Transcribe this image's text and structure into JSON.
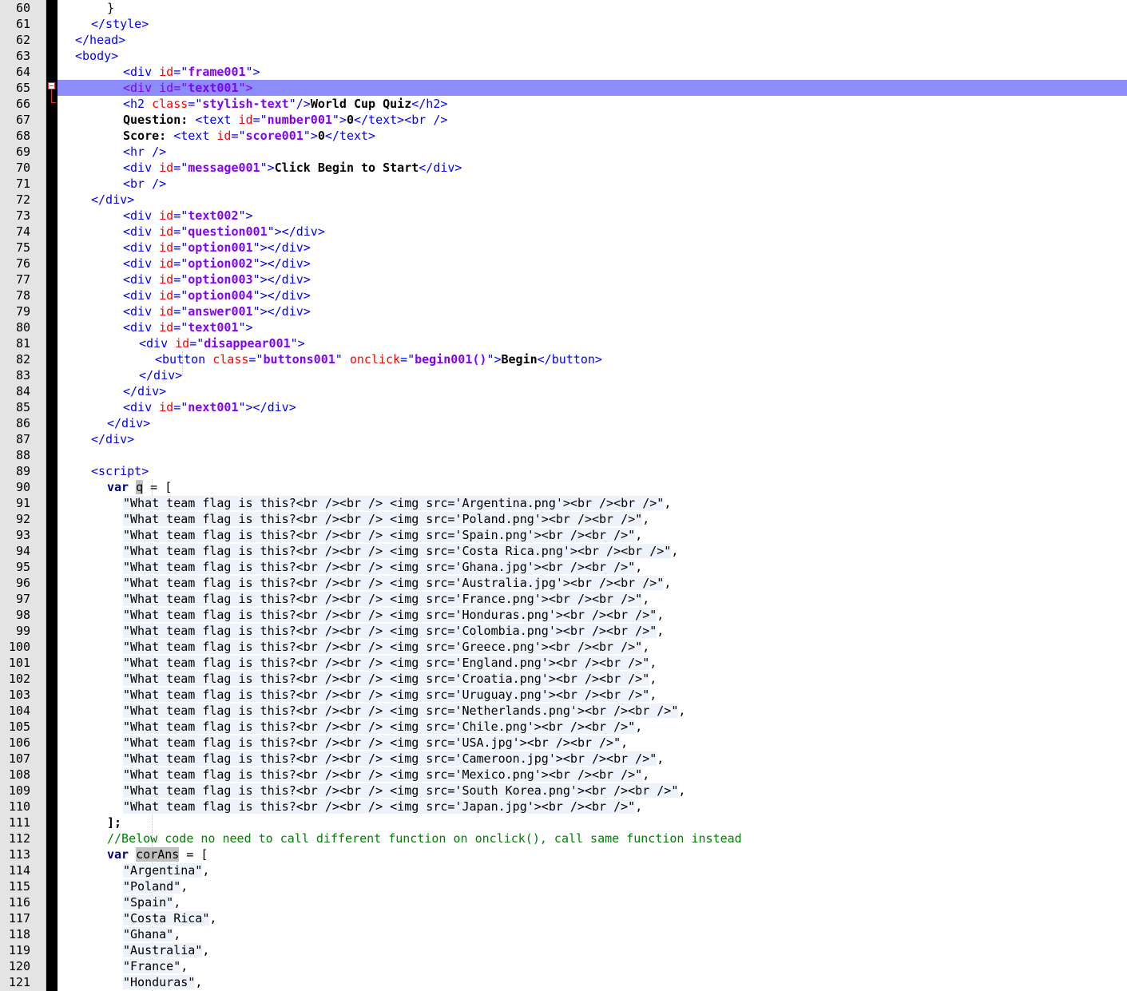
{
  "editor": {
    "lines": [
      {
        "n": "60",
        "ind": 6,
        "tok": [
          [
            "p",
            "}"
          ]
        ]
      },
      {
        "n": "61",
        "ind": 4,
        "tok": [
          [
            "t",
            "</style>"
          ]
        ]
      },
      {
        "n": "62",
        "ind": 2,
        "tok": [
          [
            "t",
            "</head>"
          ]
        ]
      },
      {
        "n": "63",
        "ind": 2,
        "tok": [
          [
            "t",
            "<body>"
          ]
        ]
      },
      {
        "n": "64",
        "ind": 8,
        "tok": [
          [
            "t",
            "<div "
          ],
          [
            "a",
            "id"
          ],
          [
            "t",
            "=\""
          ],
          [
            "v",
            "frame001"
          ],
          [
            "t",
            "\">"
          ]
        ]
      },
      {
        "n": "65",
        "ind": 8,
        "cur": true,
        "tok": [
          [
            "t",
            "<div "
          ],
          [
            "a",
            "id"
          ],
          [
            "t",
            "=\""
          ],
          [
            "v",
            "text001"
          ],
          [
            "t",
            "\">"
          ]
        ]
      },
      {
        "n": "66",
        "ind": 8,
        "tok": [
          [
            "t",
            "<h2 "
          ],
          [
            "a",
            "class"
          ],
          [
            "t",
            "=\""
          ],
          [
            "v",
            "stylish-text"
          ],
          [
            "t",
            "\"/>"
          ],
          [
            "b",
            "World Cup Quiz"
          ],
          [
            "t",
            "</h2>"
          ]
        ]
      },
      {
        "n": "67",
        "ind": 8,
        "tok": [
          [
            "b",
            "Question: "
          ],
          [
            "t",
            "<text "
          ],
          [
            "a",
            "id"
          ],
          [
            "t",
            "=\""
          ],
          [
            "v",
            "number001"
          ],
          [
            "t",
            "\">"
          ],
          [
            "b",
            "0"
          ],
          [
            "t",
            "</text><br />"
          ]
        ]
      },
      {
        "n": "68",
        "ind": 8,
        "tok": [
          [
            "b",
            "Score: "
          ],
          [
            "t",
            "<text "
          ],
          [
            "a",
            "id"
          ],
          [
            "t",
            "=\""
          ],
          [
            "v",
            "score001"
          ],
          [
            "t",
            "\">"
          ],
          [
            "b",
            "0"
          ],
          [
            "t",
            "</text>"
          ]
        ]
      },
      {
        "n": "69",
        "ind": 8,
        "tok": [
          [
            "t",
            "<hr />"
          ]
        ]
      },
      {
        "n": "70",
        "ind": 8,
        "tok": [
          [
            "t",
            "<div "
          ],
          [
            "a",
            "id"
          ],
          [
            "t",
            "=\""
          ],
          [
            "v",
            "message001"
          ],
          [
            "t",
            "\">"
          ],
          [
            "b",
            "Click Begin to Start"
          ],
          [
            "t",
            "</div>"
          ]
        ]
      },
      {
        "n": "71",
        "ind": 8,
        "tok": [
          [
            "t",
            "<br />"
          ]
        ]
      },
      {
        "n": "72",
        "ind": 4,
        "tok": [
          [
            "t",
            "</div>"
          ]
        ]
      },
      {
        "n": "73",
        "ind": 8,
        "tok": [
          [
            "t",
            "<div "
          ],
          [
            "a",
            "id"
          ],
          [
            "t",
            "=\""
          ],
          [
            "v",
            "text002"
          ],
          [
            "t",
            "\">"
          ]
        ]
      },
      {
        "n": "74",
        "ind": 8,
        "tok": [
          [
            "t",
            "<div "
          ],
          [
            "a",
            "id"
          ],
          [
            "t",
            "=\""
          ],
          [
            "v",
            "question001"
          ],
          [
            "t",
            "\"></div>"
          ]
        ]
      },
      {
        "n": "75",
        "ind": 8,
        "tok": [
          [
            "t",
            "<div "
          ],
          [
            "a",
            "id"
          ],
          [
            "t",
            "=\""
          ],
          [
            "v",
            "option001"
          ],
          [
            "t",
            "\"></div>"
          ]
        ]
      },
      {
        "n": "76",
        "ind": 8,
        "tok": [
          [
            "t",
            "<div "
          ],
          [
            "a",
            "id"
          ],
          [
            "t",
            "=\""
          ],
          [
            "v",
            "option002"
          ],
          [
            "t",
            "\"></div>"
          ]
        ]
      },
      {
        "n": "77",
        "ind": 8,
        "tok": [
          [
            "t",
            "<div "
          ],
          [
            "a",
            "id"
          ],
          [
            "t",
            "=\""
          ],
          [
            "v",
            "option003"
          ],
          [
            "t",
            "\"></div>"
          ]
        ]
      },
      {
        "n": "78",
        "ind": 8,
        "tok": [
          [
            "t",
            "<div "
          ],
          [
            "a",
            "id"
          ],
          [
            "t",
            "=\""
          ],
          [
            "v",
            "option004"
          ],
          [
            "t",
            "\"></div>"
          ]
        ]
      },
      {
        "n": "79",
        "ind": 8,
        "tok": [
          [
            "t",
            "<div "
          ],
          [
            "a",
            "id"
          ],
          [
            "t",
            "=\""
          ],
          [
            "v",
            "answer001"
          ],
          [
            "t",
            "\"></div>"
          ]
        ]
      },
      {
        "n": "80",
        "ind": 8,
        "tok": [
          [
            "t",
            "<div "
          ],
          [
            "a",
            "id"
          ],
          [
            "t",
            "=\""
          ],
          [
            "v",
            "text001"
          ],
          [
            "t",
            "\">"
          ]
        ]
      },
      {
        "n": "81",
        "ind": 10,
        "tok": [
          [
            "t",
            "<div "
          ],
          [
            "a",
            "id"
          ],
          [
            "t",
            "=\""
          ],
          [
            "v",
            "disappear001"
          ],
          [
            "t",
            "\">"
          ]
        ]
      },
      {
        "n": "82",
        "ind": 12,
        "tok": [
          [
            "t",
            "<button "
          ],
          [
            "a",
            "class"
          ],
          [
            "t",
            "=\""
          ],
          [
            "v",
            "buttons001"
          ],
          [
            "t",
            "\" "
          ],
          [
            "a",
            "onclick"
          ],
          [
            "t",
            "=\""
          ],
          [
            "v",
            "begin001()"
          ],
          [
            "t",
            "\">"
          ],
          [
            "b",
            "Begin"
          ],
          [
            "t",
            "</button>"
          ]
        ]
      },
      {
        "n": "83",
        "ind": 10,
        "tok": [
          [
            "t",
            "</div>"
          ]
        ]
      },
      {
        "n": "84",
        "ind": 8,
        "tok": [
          [
            "t",
            "</div>"
          ]
        ]
      },
      {
        "n": "85",
        "ind": 8,
        "tok": [
          [
            "t",
            "<div "
          ],
          [
            "a",
            "id"
          ],
          [
            "t",
            "=\""
          ],
          [
            "v",
            "next001"
          ],
          [
            "t",
            "\"></div>"
          ]
        ]
      },
      {
        "n": "86",
        "ind": 6,
        "tok": [
          [
            "t",
            "</div>"
          ]
        ]
      },
      {
        "n": "87",
        "ind": 4,
        "tok": [
          [
            "t",
            "</div>"
          ]
        ]
      },
      {
        "n": "88",
        "ind": 0,
        "tok": []
      },
      {
        "n": "89",
        "ind": 4,
        "tok": [
          [
            "t",
            "<script>"
          ]
        ]
      },
      {
        "n": "90",
        "ind": 6,
        "tok": [
          [
            "k",
            "var "
          ],
          [
            "hl",
            "q"
          ],
          [
            "p",
            " = ["
          ]
        ]
      },
      {
        "n": "91",
        "ind": 8,
        "tok": [
          [
            "s",
            "\"What team flag is this?<br /><br /> <img src='Argentina.png'><br /><br />\""
          ],
          [
            "p",
            ","
          ]
        ]
      },
      {
        "n": "92",
        "ind": 8,
        "tok": [
          [
            "s",
            "\"What team flag is this?<br /><br /> <img src='Poland.png'><br /><br />\""
          ],
          [
            "p",
            ","
          ]
        ]
      },
      {
        "n": "93",
        "ind": 8,
        "tok": [
          [
            "s",
            "\"What team flag is this?<br /><br /> <img src='Spain.png'><br /><br />\""
          ],
          [
            "p",
            ","
          ]
        ]
      },
      {
        "n": "94",
        "ind": 8,
        "tok": [
          [
            "s",
            "\"What team flag is this?<br /><br /> <img src='Costa Rica.png'><br /><br />\""
          ],
          [
            "p",
            ","
          ]
        ]
      },
      {
        "n": "95",
        "ind": 8,
        "tok": [
          [
            "s",
            "\"What team flag is this?<br /><br /> <img src='Ghana.jpg'><br /><br />\""
          ],
          [
            "p",
            ","
          ]
        ]
      },
      {
        "n": "96",
        "ind": 8,
        "tok": [
          [
            "s",
            "\"What team flag is this?<br /><br /> <img src='Australia.jpg'><br /><br />\""
          ],
          [
            "p",
            ","
          ]
        ]
      },
      {
        "n": "97",
        "ind": 8,
        "tok": [
          [
            "s",
            "\"What team flag is this?<br /><br /> <img src='France.png'><br /><br />\""
          ],
          [
            "p",
            ","
          ]
        ]
      },
      {
        "n": "98",
        "ind": 8,
        "tok": [
          [
            "s",
            "\"What team flag is this?<br /><br /> <img src='Honduras.png'><br /><br />\""
          ],
          [
            "p",
            ","
          ]
        ]
      },
      {
        "n": "99",
        "ind": 8,
        "tok": [
          [
            "s",
            "\"What team flag is this?<br /><br /> <img src='Colombia.png'><br /><br />\""
          ],
          [
            "p",
            ","
          ]
        ]
      },
      {
        "n": "100",
        "ind": 8,
        "tok": [
          [
            "s",
            "\"What team flag is this?<br /><br /> <img src='Greece.png'><br /><br />\""
          ],
          [
            "p",
            ","
          ]
        ]
      },
      {
        "n": "101",
        "ind": 8,
        "tok": [
          [
            "s",
            "\"What team flag is this?<br /><br /> <img src='England.png'><br /><br />\""
          ],
          [
            "p",
            ","
          ]
        ]
      },
      {
        "n": "102",
        "ind": 8,
        "tok": [
          [
            "s",
            "\"What team flag is this?<br /><br /> <img src='Croatia.png'><br /><br />\""
          ],
          [
            "p",
            ","
          ]
        ]
      },
      {
        "n": "103",
        "ind": 8,
        "tok": [
          [
            "s",
            "\"What team flag is this?<br /><br /> <img src='Uruguay.png'><br /><br />\""
          ],
          [
            "p",
            ","
          ]
        ]
      },
      {
        "n": "104",
        "ind": 8,
        "tok": [
          [
            "s",
            "\"What team flag is this?<br /><br /> <img src='Netherlands.png'><br /><br />\""
          ],
          [
            "p",
            ","
          ]
        ]
      },
      {
        "n": "105",
        "ind": 8,
        "tok": [
          [
            "s",
            "\"What team flag is this?<br /><br /> <img src='Chile.png'><br /><br />\""
          ],
          [
            "p",
            ","
          ]
        ]
      },
      {
        "n": "106",
        "ind": 8,
        "tok": [
          [
            "s",
            "\"What team flag is this?<br /><br /> <img src='USA.jpg'><br /><br />\""
          ],
          [
            "p",
            ","
          ]
        ]
      },
      {
        "n": "107",
        "ind": 8,
        "tok": [
          [
            "s",
            "\"What team flag is this?<br /><br /> <img src='Cameroon.jpg'><br /><br />\""
          ],
          [
            "p",
            ","
          ]
        ]
      },
      {
        "n": "108",
        "ind": 8,
        "tok": [
          [
            "s",
            "\"What team flag is this?<br /><br /> <img src='Mexico.png'><br /><br />\""
          ],
          [
            "p",
            ","
          ]
        ]
      },
      {
        "n": "109",
        "ind": 8,
        "tok": [
          [
            "s",
            "\"What team flag is this?<br /><br /> <img src='South Korea.png'><br /><br />\""
          ],
          [
            "p",
            ","
          ]
        ]
      },
      {
        "n": "110",
        "ind": 8,
        "tok": [
          [
            "s",
            "\"What team flag is this?<br /><br /> <img src='Japan.jpg'><br /><br />\""
          ],
          [
            "p",
            ","
          ]
        ]
      },
      {
        "n": "111",
        "ind": 6,
        "tok": [
          [
            "b",
            "];"
          ]
        ]
      },
      {
        "n": "112",
        "ind": 6,
        "tok": [
          [
            "c",
            "//Below code no need to call different function on onclick(), call same function instead"
          ]
        ]
      },
      {
        "n": "113",
        "ind": 6,
        "tok": [
          [
            "k",
            "var "
          ],
          [
            "hl",
            "corAns"
          ],
          [
            "p",
            " = ["
          ]
        ]
      },
      {
        "n": "114",
        "ind": 8,
        "tok": [
          [
            "s",
            "\"Argentina\""
          ],
          [
            "p",
            ","
          ]
        ]
      },
      {
        "n": "115",
        "ind": 8,
        "tok": [
          [
            "s",
            "\"Poland\""
          ],
          [
            "p",
            ","
          ]
        ]
      },
      {
        "n": "116",
        "ind": 8,
        "tok": [
          [
            "s",
            "\"Spain\""
          ],
          [
            "p",
            ","
          ]
        ]
      },
      {
        "n": "117",
        "ind": 8,
        "tok": [
          [
            "s",
            "\"Costa Rica\""
          ],
          [
            "p",
            ","
          ]
        ]
      },
      {
        "n": "118",
        "ind": 8,
        "tok": [
          [
            "s",
            "\"Ghana\""
          ],
          [
            "p",
            ","
          ]
        ]
      },
      {
        "n": "119",
        "ind": 8,
        "tok": [
          [
            "s",
            "\"Australia\""
          ],
          [
            "p",
            ","
          ]
        ]
      },
      {
        "n": "120",
        "ind": 8,
        "tok": [
          [
            "s",
            "\"France\""
          ],
          [
            "p",
            ","
          ]
        ]
      },
      {
        "n": "121",
        "ind": 8,
        "tok": [
          [
            "s",
            "\"Honduras\""
          ],
          [
            "p",
            ","
          ]
        ]
      }
    ]
  }
}
